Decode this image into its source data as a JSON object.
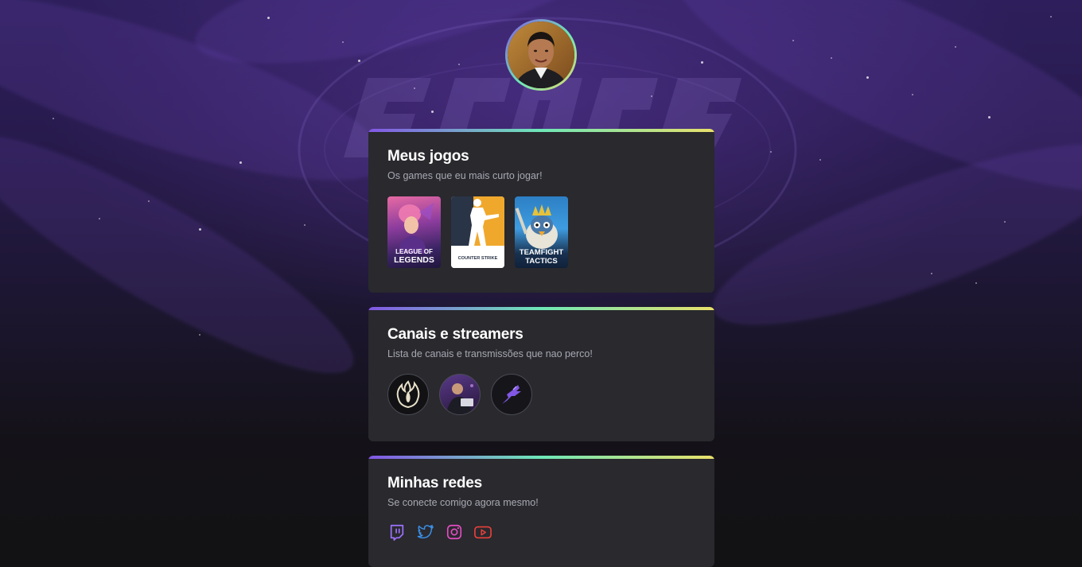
{
  "profile": {
    "avatar_alt": "Foto de perfil"
  },
  "games_section": {
    "title": "Meus jogos",
    "subtitle": "Os games que eu mais curto jogar!",
    "games": [
      {
        "name": "league-of-legends",
        "line1": "LEAGUE OF",
        "line2": "LEGENDS"
      },
      {
        "name": "counter-strike",
        "line1": "COUNTER STRIKE",
        "line2": ""
      },
      {
        "name": "teamfight-tactics",
        "line1": "TEAMFIGHT",
        "line2": "TACTICS"
      }
    ]
  },
  "channels_section": {
    "title": "Canais e streamers",
    "subtitle": "Lista de canais e transmissões que nao perco!"
  },
  "socials_section": {
    "title": "Minhas redes",
    "subtitle": "Se conecte comigo agora mesmo!",
    "icons": [
      "twitch-icon",
      "twitter-icon",
      "instagram-icon",
      "youtube-icon"
    ]
  },
  "colors": {
    "accent_purple": "#8257e5",
    "accent_green": "#6ee7b7",
    "accent_yellow": "#e9e06a",
    "card_bg": "#29292e"
  }
}
